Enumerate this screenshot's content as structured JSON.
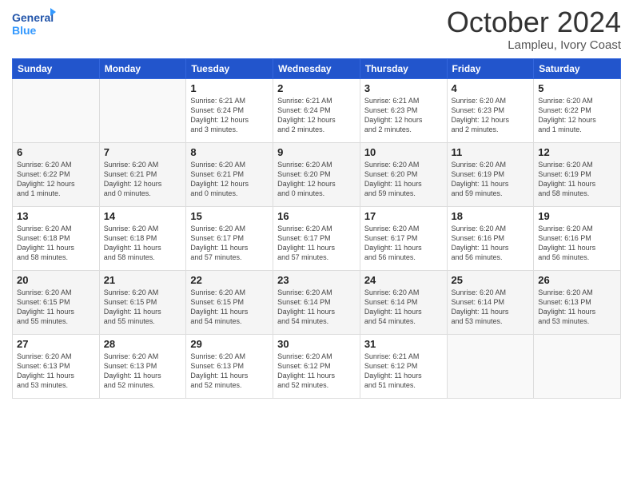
{
  "logo": {
    "line1": "General",
    "line2": "Blue"
  },
  "title": "October 2024",
  "subtitle": "Lampleu, Ivory Coast",
  "days_header": [
    "Sunday",
    "Monday",
    "Tuesday",
    "Wednesday",
    "Thursday",
    "Friday",
    "Saturday"
  ],
  "weeks": [
    [
      {
        "num": "",
        "detail": ""
      },
      {
        "num": "",
        "detail": ""
      },
      {
        "num": "1",
        "detail": "Sunrise: 6:21 AM\nSunset: 6:24 PM\nDaylight: 12 hours\nand 3 minutes."
      },
      {
        "num": "2",
        "detail": "Sunrise: 6:21 AM\nSunset: 6:24 PM\nDaylight: 12 hours\nand 2 minutes."
      },
      {
        "num": "3",
        "detail": "Sunrise: 6:21 AM\nSunset: 6:23 PM\nDaylight: 12 hours\nand 2 minutes."
      },
      {
        "num": "4",
        "detail": "Sunrise: 6:20 AM\nSunset: 6:23 PM\nDaylight: 12 hours\nand 2 minutes."
      },
      {
        "num": "5",
        "detail": "Sunrise: 6:20 AM\nSunset: 6:22 PM\nDaylight: 12 hours\nand 1 minute."
      }
    ],
    [
      {
        "num": "6",
        "detail": "Sunrise: 6:20 AM\nSunset: 6:22 PM\nDaylight: 12 hours\nand 1 minute."
      },
      {
        "num": "7",
        "detail": "Sunrise: 6:20 AM\nSunset: 6:21 PM\nDaylight: 12 hours\nand 0 minutes."
      },
      {
        "num": "8",
        "detail": "Sunrise: 6:20 AM\nSunset: 6:21 PM\nDaylight: 12 hours\nand 0 minutes."
      },
      {
        "num": "9",
        "detail": "Sunrise: 6:20 AM\nSunset: 6:20 PM\nDaylight: 12 hours\nand 0 minutes."
      },
      {
        "num": "10",
        "detail": "Sunrise: 6:20 AM\nSunset: 6:20 PM\nDaylight: 11 hours\nand 59 minutes."
      },
      {
        "num": "11",
        "detail": "Sunrise: 6:20 AM\nSunset: 6:19 PM\nDaylight: 11 hours\nand 59 minutes."
      },
      {
        "num": "12",
        "detail": "Sunrise: 6:20 AM\nSunset: 6:19 PM\nDaylight: 11 hours\nand 58 minutes."
      }
    ],
    [
      {
        "num": "13",
        "detail": "Sunrise: 6:20 AM\nSunset: 6:18 PM\nDaylight: 11 hours\nand 58 minutes."
      },
      {
        "num": "14",
        "detail": "Sunrise: 6:20 AM\nSunset: 6:18 PM\nDaylight: 11 hours\nand 58 minutes."
      },
      {
        "num": "15",
        "detail": "Sunrise: 6:20 AM\nSunset: 6:17 PM\nDaylight: 11 hours\nand 57 minutes."
      },
      {
        "num": "16",
        "detail": "Sunrise: 6:20 AM\nSunset: 6:17 PM\nDaylight: 11 hours\nand 57 minutes."
      },
      {
        "num": "17",
        "detail": "Sunrise: 6:20 AM\nSunset: 6:17 PM\nDaylight: 11 hours\nand 56 minutes."
      },
      {
        "num": "18",
        "detail": "Sunrise: 6:20 AM\nSunset: 6:16 PM\nDaylight: 11 hours\nand 56 minutes."
      },
      {
        "num": "19",
        "detail": "Sunrise: 6:20 AM\nSunset: 6:16 PM\nDaylight: 11 hours\nand 56 minutes."
      }
    ],
    [
      {
        "num": "20",
        "detail": "Sunrise: 6:20 AM\nSunset: 6:15 PM\nDaylight: 11 hours\nand 55 minutes."
      },
      {
        "num": "21",
        "detail": "Sunrise: 6:20 AM\nSunset: 6:15 PM\nDaylight: 11 hours\nand 55 minutes."
      },
      {
        "num": "22",
        "detail": "Sunrise: 6:20 AM\nSunset: 6:15 PM\nDaylight: 11 hours\nand 54 minutes."
      },
      {
        "num": "23",
        "detail": "Sunrise: 6:20 AM\nSunset: 6:14 PM\nDaylight: 11 hours\nand 54 minutes."
      },
      {
        "num": "24",
        "detail": "Sunrise: 6:20 AM\nSunset: 6:14 PM\nDaylight: 11 hours\nand 54 minutes."
      },
      {
        "num": "25",
        "detail": "Sunrise: 6:20 AM\nSunset: 6:14 PM\nDaylight: 11 hours\nand 53 minutes."
      },
      {
        "num": "26",
        "detail": "Sunrise: 6:20 AM\nSunset: 6:13 PM\nDaylight: 11 hours\nand 53 minutes."
      }
    ],
    [
      {
        "num": "27",
        "detail": "Sunrise: 6:20 AM\nSunset: 6:13 PM\nDaylight: 11 hours\nand 53 minutes."
      },
      {
        "num": "28",
        "detail": "Sunrise: 6:20 AM\nSunset: 6:13 PM\nDaylight: 11 hours\nand 52 minutes."
      },
      {
        "num": "29",
        "detail": "Sunrise: 6:20 AM\nSunset: 6:13 PM\nDaylight: 11 hours\nand 52 minutes."
      },
      {
        "num": "30",
        "detail": "Sunrise: 6:20 AM\nSunset: 6:12 PM\nDaylight: 11 hours\nand 52 minutes."
      },
      {
        "num": "31",
        "detail": "Sunrise: 6:21 AM\nSunset: 6:12 PM\nDaylight: 11 hours\nand 51 minutes."
      },
      {
        "num": "",
        "detail": ""
      },
      {
        "num": "",
        "detail": ""
      }
    ]
  ]
}
